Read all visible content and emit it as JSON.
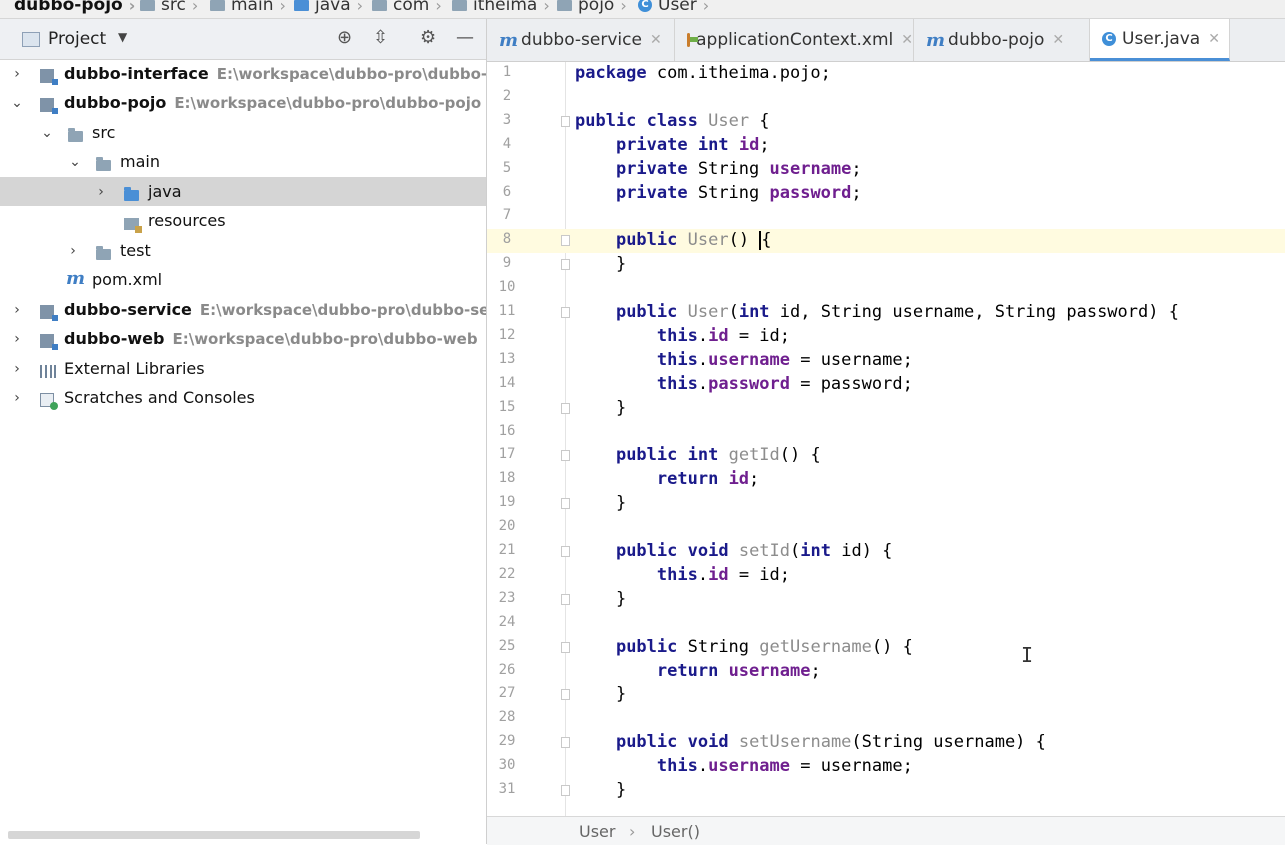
{
  "breadcrumb": {
    "items": [
      "dubbo-pojo",
      "src",
      "main",
      "java",
      "com",
      "itheima",
      "pojo",
      "User"
    ]
  },
  "project_panel": {
    "title": "Project",
    "tree": [
      {
        "label": "dubbo-interface",
        "path": "E:\\workspace\\dubbo-pro\\dubbo-"
      },
      {
        "label": "dubbo-pojo",
        "path": "E:\\workspace\\dubbo-pro\\dubbo-pojo"
      },
      {
        "label": "src"
      },
      {
        "label": "main"
      },
      {
        "label": "java"
      },
      {
        "label": "resources"
      },
      {
        "label": "test"
      },
      {
        "label": "pom.xml"
      },
      {
        "label": "dubbo-service",
        "path": "E:\\workspace\\dubbo-pro\\dubbo-se"
      },
      {
        "label": "dubbo-web",
        "path": "E:\\workspace\\dubbo-pro\\dubbo-web"
      },
      {
        "label": "External Libraries"
      },
      {
        "label": "Scratches and Consoles"
      }
    ]
  },
  "tabs": [
    {
      "label": "dubbo-service",
      "active": false
    },
    {
      "label": "applicationContext.xml",
      "active": false
    },
    {
      "label": "dubbo-pojo",
      "active": false
    },
    {
      "label": "User.java",
      "active": true
    }
  ],
  "editor": {
    "lines": [
      "package com.itheima.pojo;",
      "",
      "public class User {",
      "    private int id;",
      "    private String username;",
      "    private String password;",
      "",
      "    public User() {",
      "    }",
      "",
      "    public User(int id, String username, String password) {",
      "        this.id = id;",
      "        this.username = username;",
      "        this.password = password;",
      "    }",
      "",
      "    public int getId() {",
      "        return id;",
      "    }",
      "",
      "    public void setId(int id) {",
      "        this.id = id;",
      "    }",
      "",
      "    public String getUsername() {",
      "        return username;",
      "    }",
      "",
      "    public void setUsername(String username) {",
      "        this.username = username;",
      "    }"
    ],
    "current_line": 8
  },
  "editor_nav": {
    "items": [
      "User",
      "User()"
    ]
  },
  "colors": {
    "keyword": "#1a1a8a",
    "field": "#6f1f8f",
    "method_name": "#8c8c8c",
    "selection": "#d5d5d5",
    "current_line": "#fffbe0",
    "accent": "#4a8fd6"
  }
}
